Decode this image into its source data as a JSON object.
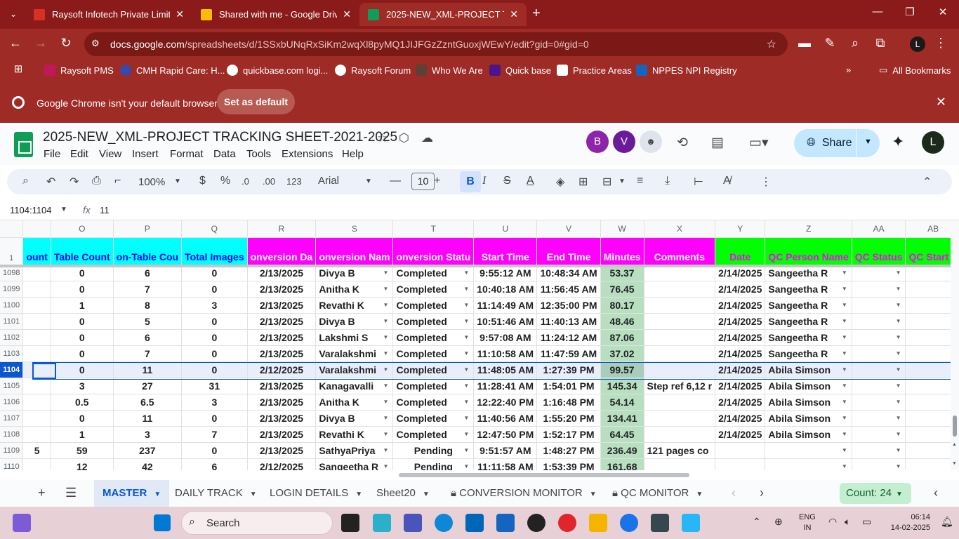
{
  "browser": {
    "tabs": [
      {
        "title": "Raysoft Infotech Private Limited",
        "color": "#d93025"
      },
      {
        "title": "Shared with me - Google Drive",
        "color": "#fbbc04"
      },
      {
        "title": "2025-NEW_XML-PROJECT TRACKING",
        "color": "#0f9d58"
      }
    ],
    "url_host": "docs.google.com",
    "url_path": "/spreadsheets/d/1SSxbUNqRxSiKm2wqXl8pyMQ1JIJFGzZzntGuoxjWEwY/edit?gid=0#gid=0",
    "profile_initial": "L",
    "bookmarks": [
      "Raysoft PMS",
      "CMH Rapid Care: H...",
      "quickbase.com logi...",
      "Raysoft Forum",
      "Who We Are",
      "Quick base",
      "Practice Areas",
      "NPPES NPI Registry"
    ],
    "all_bookmarks": "All Bookmarks",
    "infobar_message": "Google Chrome isn't your default browser",
    "infobar_button": "Set as default"
  },
  "sheets": {
    "title": "2025-NEW_XML-PROJECT TRACKING SHEET-2021-2025",
    "menu": [
      "File",
      "Edit",
      "View",
      "Insert",
      "Format",
      "Data",
      "Tools",
      "Extensions",
      "Help"
    ],
    "collaborators": [
      "B",
      "V"
    ],
    "share_label": "Share",
    "user_initial": "L",
    "zoom": "100%",
    "currency": "$",
    "percent": "%",
    "dec_less": ".0",
    "dec_more": ".00",
    "number_format": "123",
    "font": "Arial",
    "font_size": "10",
    "name_box": "1104:1104",
    "fx": "fx",
    "formula_value": "11"
  },
  "grid": {
    "columns": [
      "O",
      "P",
      "Q",
      "R",
      "S",
      "T",
      "U",
      "V",
      "W",
      "X",
      "Y",
      "Z",
      "AA",
      "AB"
    ],
    "headers": [
      "ount",
      "Table Count",
      "on-Table Cou",
      "Total Images",
      "onversion Da",
      "onversion Nam",
      "onversion Statu",
      "Start Time",
      "End Time",
      "Minutes",
      "Comments",
      "Date",
      "QC Person Name",
      "QC Status",
      "QC Start T"
    ],
    "header_row_number": "1",
    "rows": [
      {
        "num": "1098",
        "n": "",
        "o": "0",
        "p": "6",
        "q": "0",
        "r": "2/13/2025",
        "s": "Divya B",
        "t": "Completed",
        "u": "9:55:12 AM",
        "v": "10:48:34 AM",
        "w": "53.37",
        "x": "",
        "y": "2/14/2025",
        "z": "Sangeetha R"
      },
      {
        "num": "1099",
        "n": "",
        "o": "0",
        "p": "7",
        "q": "0",
        "r": "2/13/2025",
        "s": "Anitha K",
        "t": "Completed",
        "u": "10:40:18 AM",
        "v": "11:56:45 AM",
        "w": "76.45",
        "x": "",
        "y": "2/14/2025",
        "z": "Sangeetha R"
      },
      {
        "num": "1100",
        "n": "",
        "o": "1",
        "p": "8",
        "q": "3",
        "r": "2/13/2025",
        "s": "Revathi K",
        "t": "Completed",
        "u": "11:14:49 AM",
        "v": "12:35:00 PM",
        "w": "80.17",
        "x": "",
        "y": "2/14/2025",
        "z": "Sangeetha R"
      },
      {
        "num": "1101",
        "n": "",
        "o": "0",
        "p": "5",
        "q": "0",
        "r": "2/13/2025",
        "s": "Divya B",
        "t": "Completed",
        "u": "10:51:46 AM",
        "v": "11:40:13 AM",
        "w": "48.46",
        "x": "",
        "y": "2/14/2025",
        "z": "Sangeetha R"
      },
      {
        "num": "1102",
        "n": "",
        "o": "0",
        "p": "6",
        "q": "0",
        "r": "2/13/2025",
        "s": "Lakshmi S",
        "t": "Completed",
        "u": "9:57:08 AM",
        "v": "11:24:12 AM",
        "w": "87.06",
        "x": "",
        "y": "2/14/2025",
        "z": "Sangeetha R"
      },
      {
        "num": "1103",
        "n": "",
        "o": "0",
        "p": "7",
        "q": "0",
        "r": "2/13/2025",
        "s": "Varalakshmi",
        "t": "Completed",
        "u": "11:10:58 AM",
        "v": "11:47:59 AM",
        "w": "37.02",
        "x": "",
        "y": "2/14/2025",
        "z": "Sangeetha R"
      },
      {
        "num": "1104",
        "n": "",
        "o": "0",
        "p": "11",
        "q": "0",
        "r": "2/12/2025",
        "s": "Varalakshmi",
        "t": "Completed",
        "u": "11:48:05 AM",
        "v": "1:27:39 PM",
        "w": "99.57",
        "x": "",
        "y": "2/14/2025",
        "z": "Abila Simson"
      },
      {
        "num": "1105",
        "n": "",
        "o": "3",
        "p": "27",
        "q": "31",
        "r": "2/13/2025",
        "s": "Kanagavalli",
        "t": "Completed",
        "u": "11:28:41 AM",
        "v": "1:54:01 PM",
        "w": "145.34",
        "x": "Step ref 6,12 r",
        "y": "2/14/2025",
        "z": "Abila Simson"
      },
      {
        "num": "1106",
        "n": "",
        "o": "0.5",
        "p": "6.5",
        "q": "3",
        "r": "2/13/2025",
        "s": "Anitha K",
        "t": "Completed",
        "u": "12:22:40 PM",
        "v": "1:16:48 PM",
        "w": "54.14",
        "x": "",
        "y": "2/14/2025",
        "z": "Abila Simson"
      },
      {
        "num": "1107",
        "n": "",
        "o": "0",
        "p": "11",
        "q": "0",
        "r": "2/13/2025",
        "s": "Divya B",
        "t": "Completed",
        "u": "11:40:56 AM",
        "v": "1:55:20 PM",
        "w": "134.41",
        "x": "",
        "y": "2/14/2025",
        "z": "Abila Simson"
      },
      {
        "num": "1108",
        "n": "",
        "o": "1",
        "p": "3",
        "q": "7",
        "r": "2/13/2025",
        "s": "Revathi K",
        "t": "Completed",
        "u": "12:47:50 PM",
        "v": "1:52:17 PM",
        "w": "64.45",
        "x": "",
        "y": "2/14/2025",
        "z": "Abila Simson"
      },
      {
        "num": "1109",
        "n": "5",
        "o": "59",
        "p": "237",
        "q": "0",
        "r": "2/13/2025",
        "s": "SathyaPriya",
        "t": "Pending",
        "u": "9:51:57 AM",
        "v": "1:48:27 PM",
        "w": "236.49",
        "x": "121 pages co",
        "y": "",
        "z": ""
      },
      {
        "num": "1110",
        "n": "",
        "o": "12",
        "p": "42",
        "q": "6",
        "r": "2/12/2025",
        "s": "Sangeetha R",
        "t": "Pending",
        "u": "11:11:58 AM",
        "v": "1:53:39 PM",
        "w": "161.68",
        "x": "",
        "y": "",
        "z": ""
      }
    ]
  },
  "sheet_tabs": {
    "tabs": [
      "MASTER",
      "DAILY TRACK",
      "LOGIN DETAILS",
      "Sheet20",
      "CONVERSION MONITOR",
      "QC MONITOR"
    ],
    "count": "Count: 24"
  },
  "taskbar": {
    "search_label": "Search",
    "lang_1": "ENG",
    "lang_2": "IN",
    "time": "06:14",
    "date": "14-02-2025"
  }
}
